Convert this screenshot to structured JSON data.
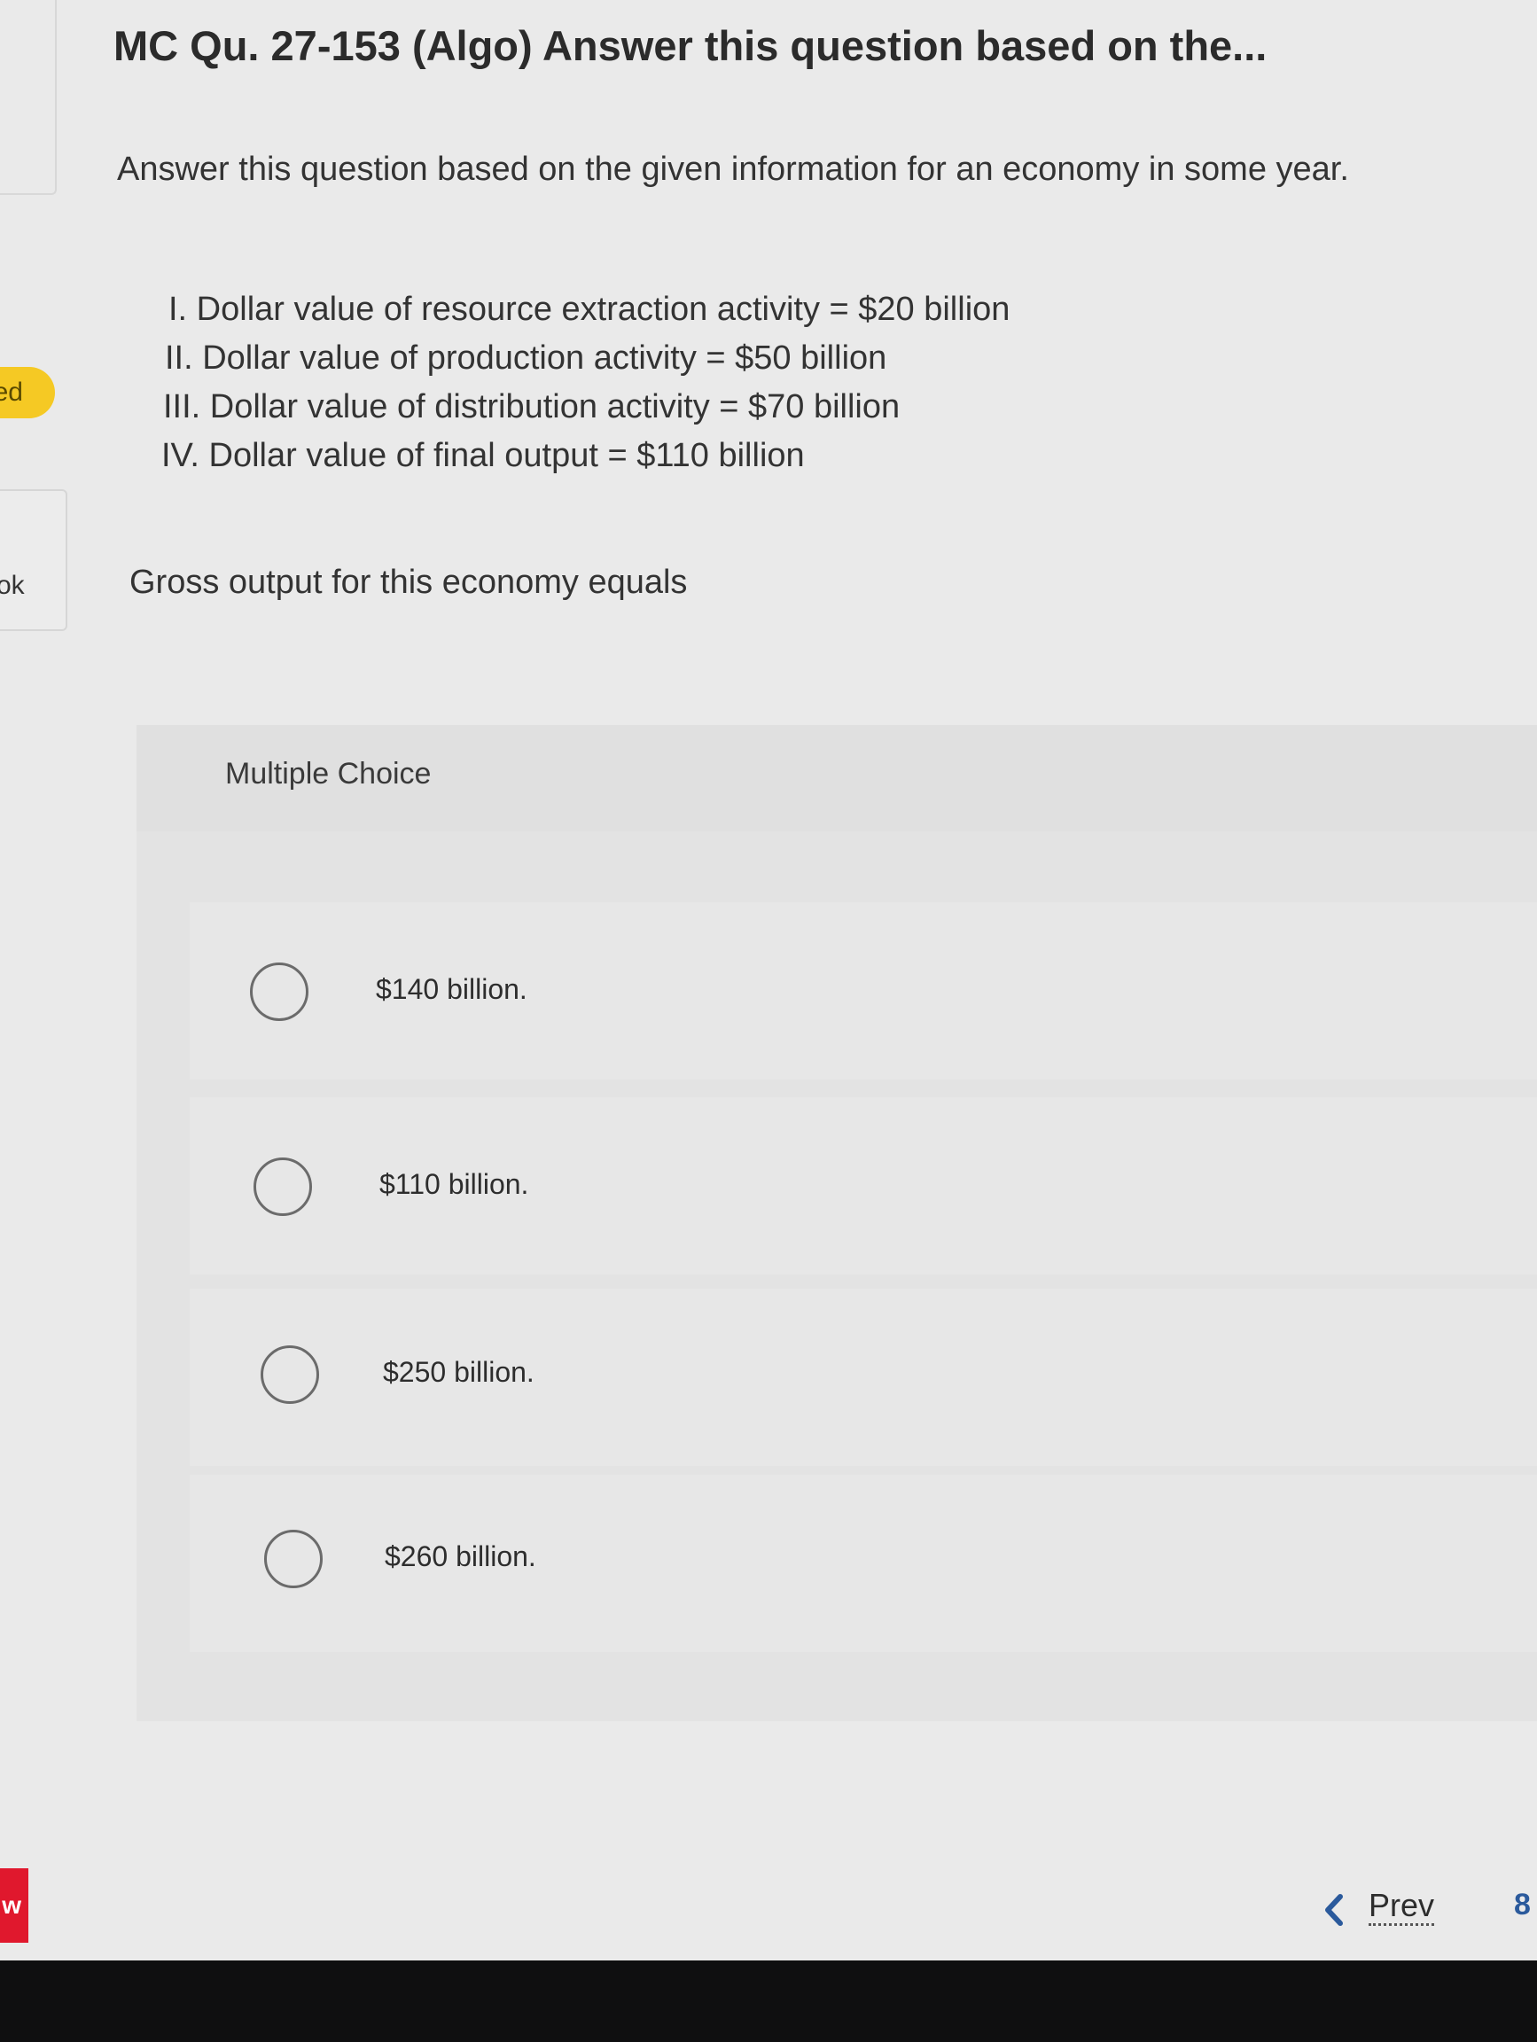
{
  "header": {
    "title": "MC Qu. 27-153 (Algo) Answer this question based on the..."
  },
  "sidebar": {
    "badge_text": "ed",
    "item_text": "ok",
    "red_tab_text": "w"
  },
  "question": {
    "intro": "Answer this question based on the given information for an economy in some year.",
    "items": [
      "I. Dollar value of resource extraction activity = $20 billion",
      "II. Dollar value of production activity = $50 billion",
      "III. Dollar value of distribution activity = $70 billion",
      "IV. Dollar value of final output = $110 billion"
    ],
    "prompt": "Gross output for this economy equals"
  },
  "multiple_choice": {
    "label": "Multiple Choice",
    "options": [
      "$140 billion.",
      "$110 billion.",
      "$250 billion.",
      "$260 billion."
    ]
  },
  "navigation": {
    "prev_label": "Prev",
    "page_number": "8"
  },
  "colors": {
    "badge": "#f5c924",
    "red_tab": "#e0182d",
    "page_number": "#2b5a9c"
  }
}
